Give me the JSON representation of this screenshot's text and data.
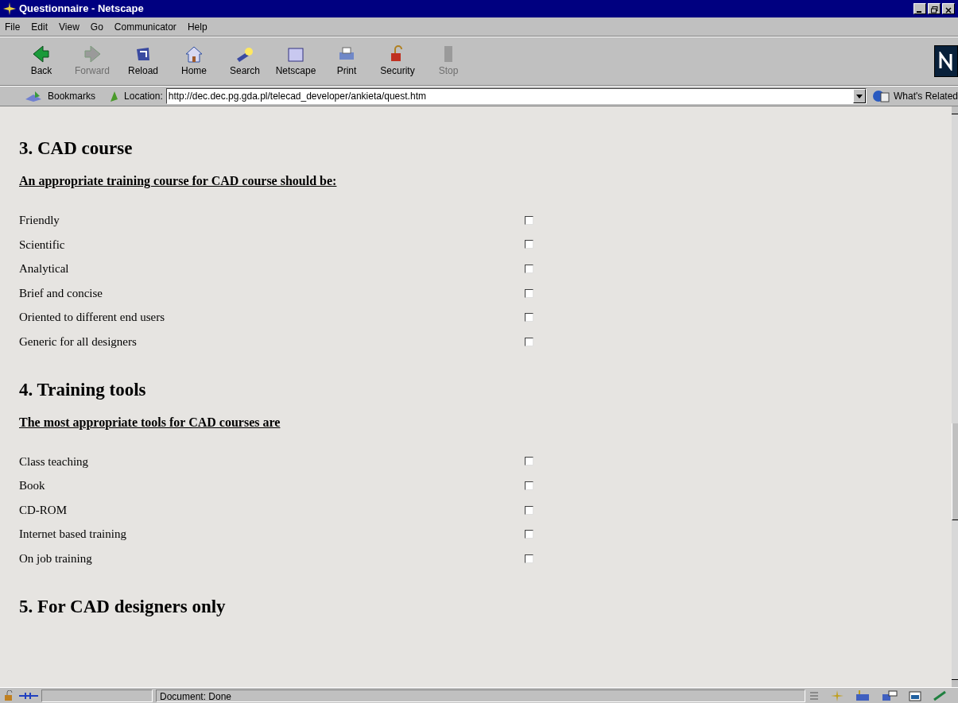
{
  "window": {
    "title": "Questionnaire - Netscape"
  },
  "menu": [
    "File",
    "Edit",
    "View",
    "Go",
    "Communicator",
    "Help"
  ],
  "toolbar": [
    {
      "label": "Back",
      "disabled": false
    },
    {
      "label": "Forward",
      "disabled": true
    },
    {
      "label": "Reload",
      "disabled": false
    },
    {
      "label": "Home",
      "disabled": false
    },
    {
      "label": "Search",
      "disabled": false
    },
    {
      "label": "Netscape",
      "disabled": false
    },
    {
      "label": "Print",
      "disabled": false
    },
    {
      "label": "Security",
      "disabled": false
    },
    {
      "label": "Stop",
      "disabled": true
    }
  ],
  "location_bar": {
    "bookmarks": "Bookmarks",
    "location_label": "Location:",
    "url": "http://dec.dec.pg.gda.pl/telecad_developer/ankieta/quest.htm",
    "related": "What's Related"
  },
  "sections": [
    {
      "heading": "3. CAD course",
      "question": "An appropriate training course for CAD course should be:",
      "options": [
        {
          "label": "Friendly",
          "checked": false
        },
        {
          "label": "Scientific",
          "checked": false
        },
        {
          "label": "Analytical",
          "checked": false
        },
        {
          "label": "Brief and concise",
          "checked": false
        },
        {
          "label": "Oriented to different end users",
          "checked": false
        },
        {
          "label": "Generic for all designers",
          "checked": false
        }
      ]
    },
    {
      "heading": "4. Training tools",
      "question": "The most appropriate tools for CAD courses are",
      "options": [
        {
          "label": "Class teaching",
          "checked": false
        },
        {
          "label": "Book",
          "checked": false
        },
        {
          "label": "CD-ROM",
          "checked": false
        },
        {
          "label": "Internet based training",
          "checked": false
        },
        {
          "label": "On job training",
          "checked": false
        }
      ]
    },
    {
      "heading": "5. For CAD designers only"
    }
  ],
  "status_bar": {
    "text": "Document: Done"
  }
}
